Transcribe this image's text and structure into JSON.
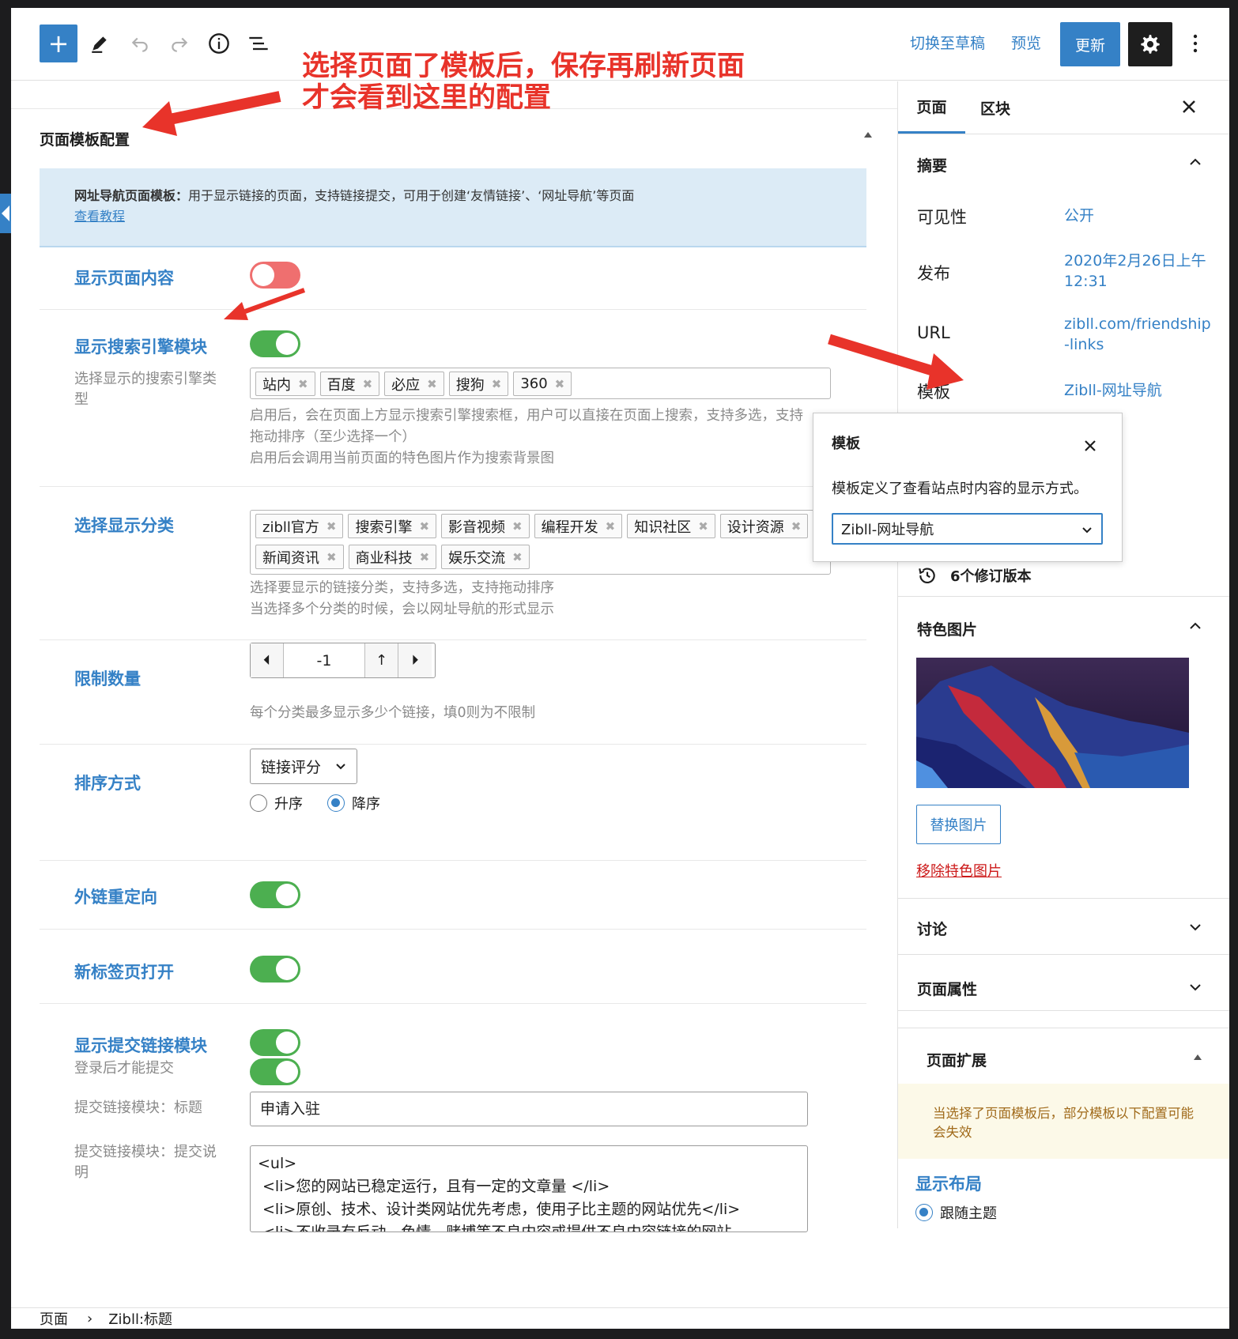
{
  "toolbar": {
    "add_label": "+",
    "switch_draft": "切换至草稿",
    "preview": "预览",
    "update": "更新"
  },
  "annotations": {
    "line1": "选择页面了模板后，保存再刷新页面",
    "line2": "才会看到这里的配置"
  },
  "panel": {
    "title": "页面模板配置",
    "notice_bold": "网址导航页面模板：",
    "notice_text": "用于显示链接的页面，支持链接提交，可用于创建‘友情链接’、‘网址导航’等页面",
    "notice_link": "查看教程",
    "show_content_label": "显示页面内容",
    "show_search_label": "显示搜索引擎模块",
    "search_types_label": "选择显示的搜索引擎类型",
    "search_tags": [
      "站内",
      "百度",
      "必应",
      "搜狗",
      "360"
    ],
    "search_help_1": "启用后，会在页面上方显示搜索引擎搜索框，用户可以直接在页面上搜索，支持多选，支持拖动排序（至少选择一个）",
    "search_help_2": "启用后会调用当前页面的特色图片作为搜索背景图",
    "category_label": "选择显示分类",
    "category_tags": [
      "zibll官方",
      "搜索引擎",
      "影音视频",
      "编程开发",
      "知识社区",
      "设计资源",
      "新闻资讯",
      "商业科技",
      "娱乐交流"
    ],
    "category_help_1": "选择要显示的链接分类，支持多选，支持拖动排序",
    "category_help_2": "当选择多个分类的时候，会以网址导航的形式显示",
    "limit_label": "限制数量",
    "limit_value": "-1",
    "limit_help": "每个分类最多显示多少个链接，填0则为不限制",
    "sort_label": "排序方式",
    "sort_value": "链接评分",
    "order_asc": "升序",
    "order_desc": "降序",
    "redirect_label": "外链重定向",
    "new_tab_label": "新标签页打开",
    "submit_module_label": "显示提交链接模块",
    "login_submit_label": "登录后才能提交",
    "submit_title_label": "提交链接模块：标题",
    "submit_title_value": "申请入驻",
    "submit_desc_label": "提交链接模块：提交说明",
    "submit_desc_lines": [
      "<ul>",
      "<li>您的网站已稳定运行，且有一定的文章量 </li>",
      "<li>原创、技术、设计类网站优先考虑，使用子比主题的网站优先</li>",
      "<li>不收录有反动、色情、赌博等不良内容或提供不良内容链接的网站"
    ]
  },
  "sidebar": {
    "tab_page": "页面",
    "tab_block": "区块",
    "summary": "摘要",
    "visibility_key": "可见性",
    "visibility_value": "公开",
    "publish_key": "发布",
    "publish_value": "2020年2月26日上午12:31",
    "url_key": "URL",
    "url_value": "zibll.com/friendship-links",
    "template_key": "模板",
    "template_value": "Zibll-网址导航",
    "revisions": "6个修订版本",
    "featured_image": "特色图片",
    "replace_image": "替换图片",
    "remove_image": "移除特色图片",
    "discussion": "讨论",
    "page_attributes": "页面属性",
    "page_extension": "页面扩展",
    "ext_notice": "当选择了页面模板后，部分模板以下配置可能会失效",
    "layout_label": "显示布局",
    "layout_option": "跟随主题"
  },
  "popover": {
    "title": "模板",
    "desc": "模板定义了查看站点时内容的显示方式。",
    "selected": "Zibll-网址导航"
  },
  "footer": {
    "crumb1": "页面",
    "crumb2": "Zibll:标题"
  },
  "colors": {
    "accent": "#3581c6",
    "toggle_on": "#4caf50",
    "toggle_off": "#ef6f6f",
    "annotation": "#e8332a"
  }
}
